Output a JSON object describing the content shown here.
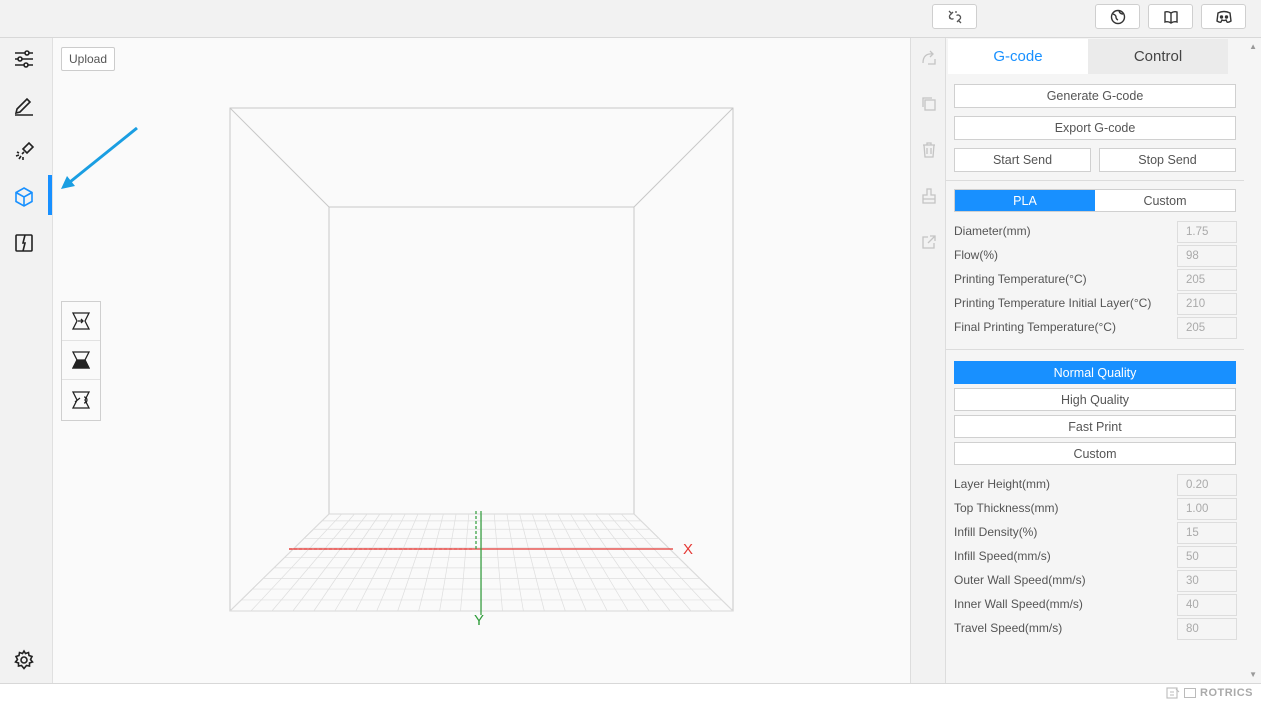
{
  "topbar": {
    "icons": [
      "unlink-icon",
      "globe-icon",
      "book-icon",
      "discord-icon"
    ]
  },
  "sidebar": {
    "items": [
      {
        "name": "settings-sliders-icon"
      },
      {
        "name": "pen-icon"
      },
      {
        "name": "laser-icon"
      },
      {
        "name": "cube-icon",
        "active": true
      },
      {
        "name": "book-open-icon"
      }
    ],
    "bottom_icon": "gear-icon"
  },
  "canvas": {
    "upload_label": "Upload",
    "axis_x_label": "X",
    "axis_y_label": "Y",
    "tools": [
      "view-front-icon",
      "view-top-icon",
      "view-side-icon"
    ]
  },
  "panel": {
    "tabs": [
      {
        "label": "G-code",
        "active": true
      },
      {
        "label": "Control",
        "active": false
      }
    ],
    "generate_label": "Generate G-code",
    "export_label": "Export G-code",
    "start_send_label": "Start Send",
    "stop_send_label": "Stop Send",
    "material": {
      "options": [
        "PLA",
        "Custom"
      ],
      "selected": "PLA"
    },
    "material_fields": [
      {
        "label": "Diameter(mm)",
        "value": "1.75"
      },
      {
        "label": "Flow(%)",
        "value": "98"
      },
      {
        "label": "Printing Temperature(°C)",
        "value": "205"
      },
      {
        "label": "Printing Temperature Initial Layer(°C)",
        "value": "210"
      },
      {
        "label": "Final Printing Temperature(°C)",
        "value": "205"
      }
    ],
    "quality": {
      "options": [
        "Normal Quality",
        "High Quality",
        "Fast Print",
        "Custom"
      ],
      "selected": "Normal Quality"
    },
    "quality_fields": [
      {
        "label": "Layer Height(mm)",
        "value": "0.20"
      },
      {
        "label": "Top Thickness(mm)",
        "value": "1.00"
      },
      {
        "label": "Infill Density(%)",
        "value": "15"
      },
      {
        "label": "Infill Speed(mm/s)",
        "value": "50"
      },
      {
        "label": "Outer Wall Speed(mm/s)",
        "value": "30"
      },
      {
        "label": "Inner Wall Speed(mm/s)",
        "value": "40"
      },
      {
        "label": "Travel Speed(mm/s)",
        "value": "80"
      }
    ]
  },
  "status": {
    "brand": "ROTRICS"
  },
  "colors": {
    "accent": "#1890ff",
    "axis_x": "#e53935",
    "axis_y": "#2e9c3a"
  }
}
